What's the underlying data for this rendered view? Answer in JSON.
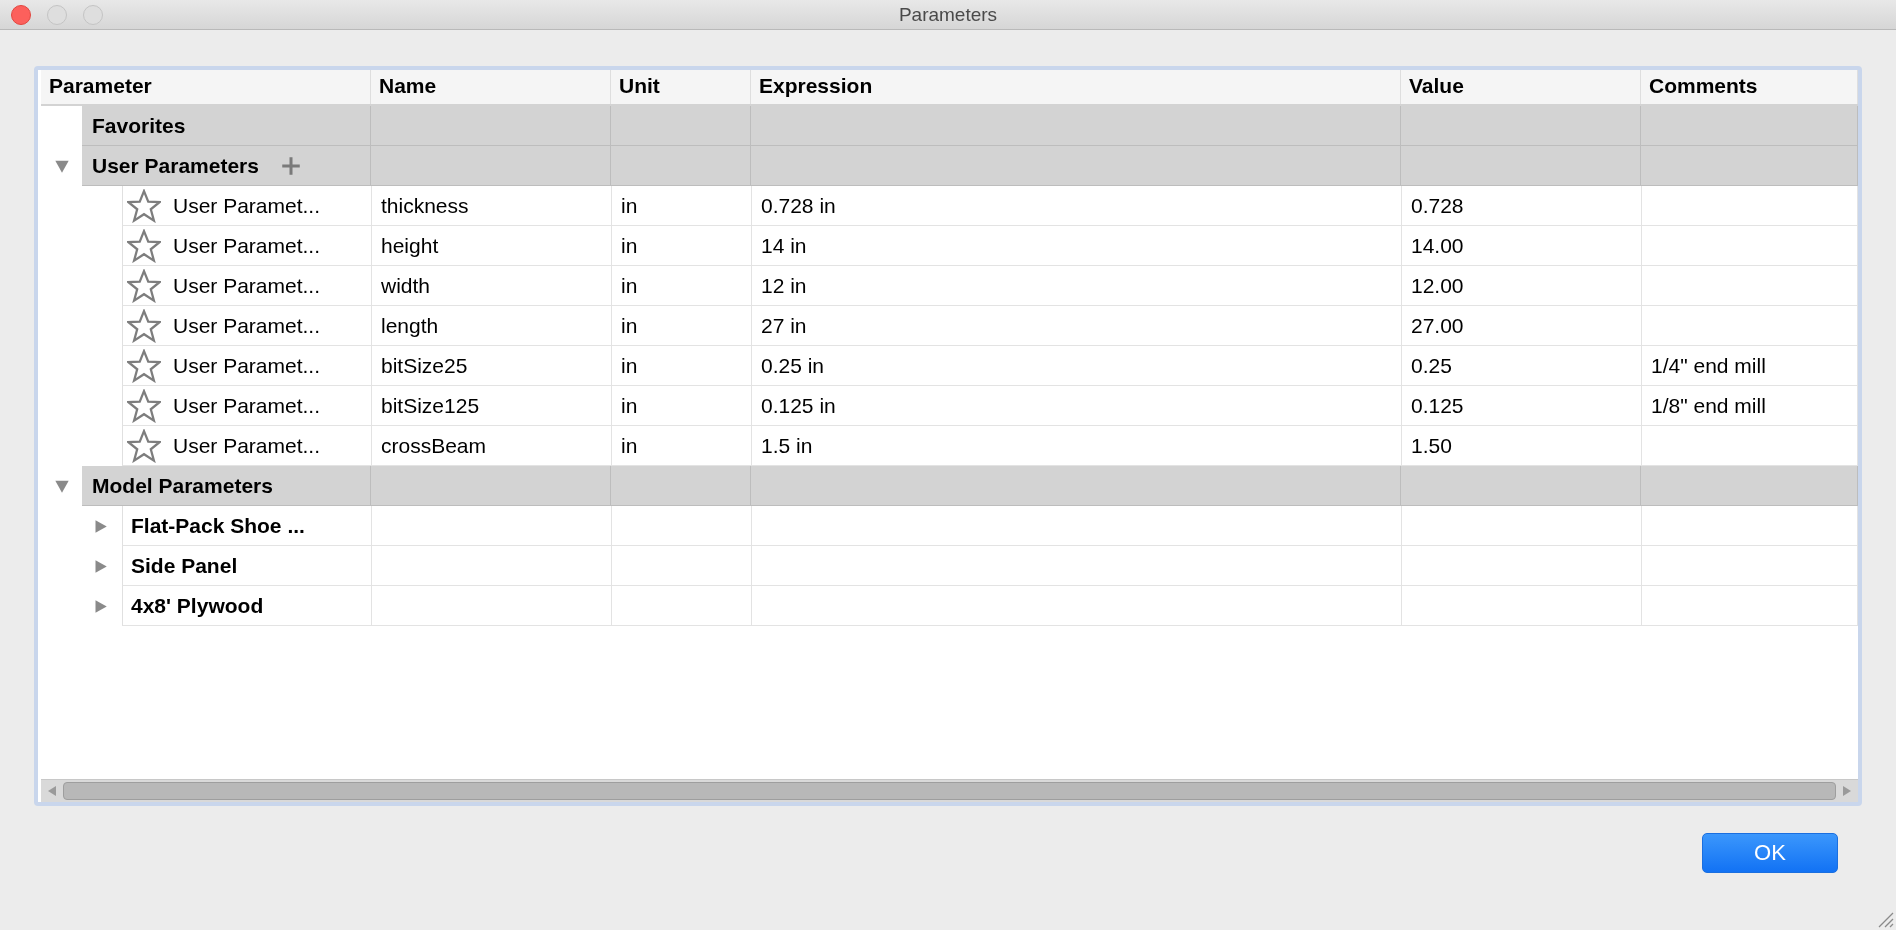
{
  "window": {
    "title": "Parameters"
  },
  "table": {
    "columns": [
      "Parameter",
      "Name",
      "Unit",
      "Expression",
      "Value",
      "Comments"
    ],
    "groups": [
      {
        "kind": "favorites",
        "label": "Favorites"
      },
      {
        "kind": "user",
        "label": "User Parameters",
        "expanded": true,
        "rows": [
          {
            "parameter": "User Paramet...",
            "name": "thickness",
            "unit": "in",
            "expression": "0.728 in",
            "value": "0.728",
            "favorite": false
          },
          {
            "parameter": "User Paramet...",
            "name": "height",
            "unit": "in",
            "expression": "14 in",
            "value": "14.00",
            "favorite": false
          },
          {
            "parameter": "User Paramet...",
            "name": "width",
            "unit": "in",
            "expression": "12 in",
            "value": "12.00",
            "favorite": false
          },
          {
            "parameter": "User Paramet...",
            "name": "length",
            "unit": "in",
            "expression": "27 in",
            "value": "27.00",
            "favorite": false
          },
          {
            "parameter": "User Paramet...",
            "name": "bitSize25",
            "unit": "in",
            "expression": "0.25 in",
            "value": "0.25",
            "comments": "1/4\" end mill",
            "favorite": false
          },
          {
            "parameter": "User Paramet...",
            "name": "bitSize125",
            "unit": "in",
            "expression": "0.125 in",
            "value": "0.125",
            "comments": "1/8\" end mill",
            "favorite": false
          },
          {
            "parameter": "User Paramet...",
            "name": "crossBeam",
            "unit": "in",
            "expression": "1.5 in",
            "value": "1.50",
            "favorite": false
          }
        ]
      },
      {
        "kind": "model",
        "label": "Model Parameters",
        "expanded": true,
        "children": [
          {
            "label": "Flat-Pack Shoe ...",
            "expanded": false
          },
          {
            "label": "Side Panel",
            "expanded": false
          },
          {
            "label": "4x8' Plywood",
            "expanded": false
          }
        ]
      }
    ]
  },
  "buttons": [
    {
      "label": "OK"
    }
  ]
}
